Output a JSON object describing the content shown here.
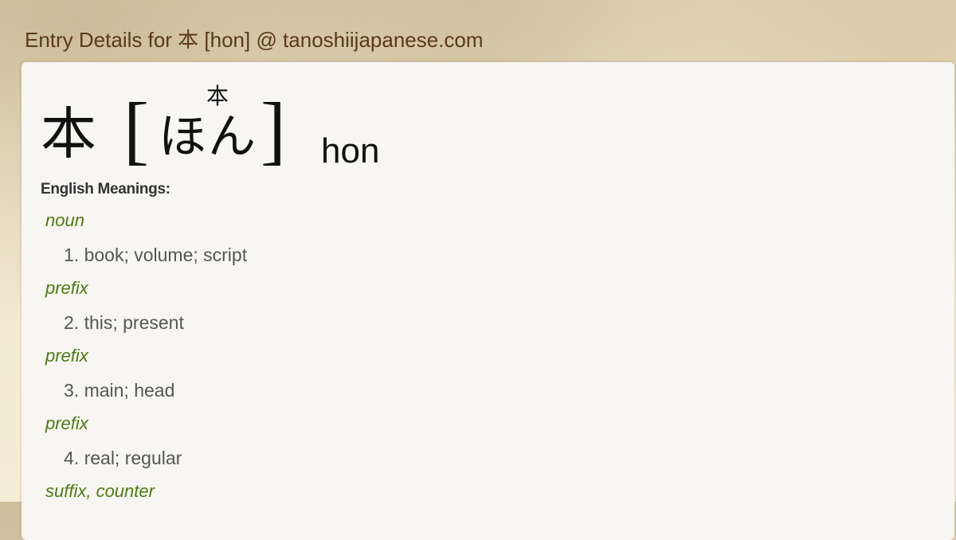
{
  "page": {
    "title": "Entry Details for 本 [hon] @ tanoshiijapanese.com"
  },
  "entry": {
    "kanji": "本",
    "furigana": "本",
    "reading": "ほん",
    "bracket_open": "[",
    "bracket_close": "]",
    "romaji": "hon",
    "meanings_label": "English Meanings:",
    "senses": [
      {
        "pos": "noun",
        "text": "1. book; volume; script"
      },
      {
        "pos": "prefix",
        "text": "2. this; present"
      },
      {
        "pos": "prefix",
        "text": "3. main; head"
      },
      {
        "pos": "prefix",
        "text": "4. real; regular"
      },
      {
        "pos": "suffix, counter",
        "text": ""
      }
    ]
  },
  "colors": {
    "header_text": "#5b3a16",
    "pos_text": "#4e7a12",
    "sense_text": "#555555",
    "card_bg": "#f7f6f2"
  }
}
